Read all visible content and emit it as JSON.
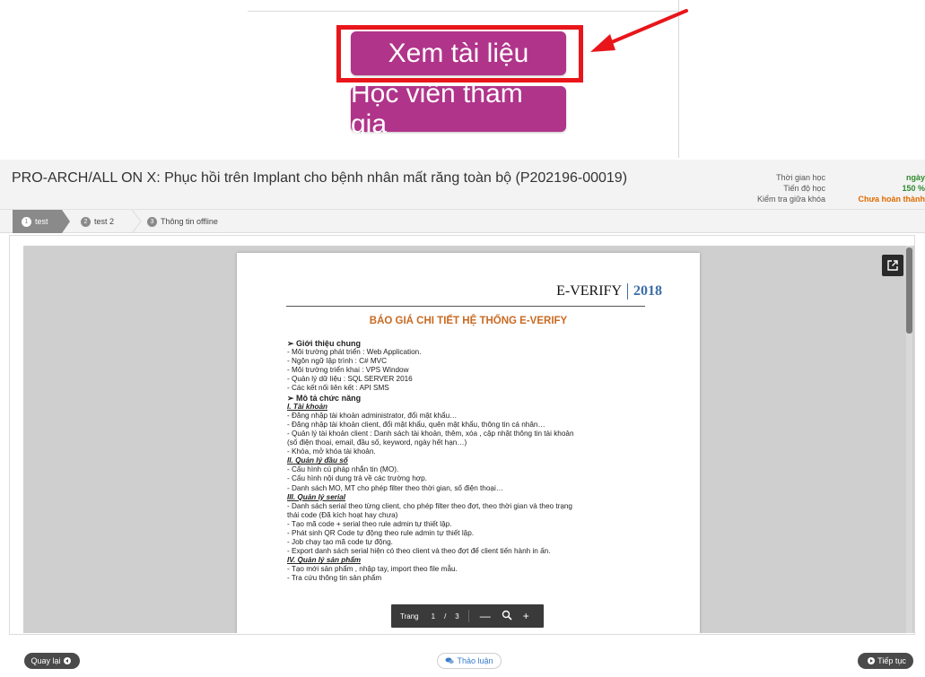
{
  "callout": {
    "primary_button": "Xem tài liệu",
    "secondary_button": "Học viên tham gia"
  },
  "header": {
    "course_title": "PRO-ARCH/ALL ON X: Phục hồi trên Implant cho bệnh nhân mất răng toàn bộ (P202196-00019)",
    "meta_labels": [
      "Thời gian học",
      "Tiến độ học",
      "Kiểm tra giữa khóa"
    ],
    "meta_values": [
      "ngày",
      "150 %",
      "Chưa hoàn thành"
    ]
  },
  "tabs": [
    {
      "num": "1",
      "label": "test"
    },
    {
      "num": "2",
      "label": "test 2"
    },
    {
      "num": "3",
      "label": "Thông tin offline"
    }
  ],
  "document": {
    "brand": "E-VERIFY",
    "year": "2018",
    "title": "BÁO GIÁ CHI TIẾT HỆ THỐNG E-VERIFY",
    "lines": [
      {
        "t": "➢  Giới thiệu chung",
        "k": "h"
      },
      {
        "t": "-    Môi trường phát triển : Web Application.",
        "k": "b"
      },
      {
        "t": "-    Ngôn ngữ lập trình : C# MVC",
        "k": "b"
      },
      {
        "t": "-    Môi trường triển khai : VPS Window",
        "k": "b"
      },
      {
        "t": "-    Quản lý dữ liệu : SQL SERVER 2016",
        "k": "b"
      },
      {
        "t": "-    Các kết nối liên kết : API SMS",
        "k": "b"
      },
      {
        "t": "➢  Mô tả chức năng",
        "k": "h"
      },
      {
        "t": "I.     Tài khoản",
        "k": "r"
      },
      {
        "t": "-    Đăng nhập tài khoản administrator, đổi mật khẩu…",
        "k": "b"
      },
      {
        "t": "-    Đăng nhập tài khoản client, đổi mật khẩu, quên mật khẩu, thông tin cá nhân…",
        "k": "b"
      },
      {
        "t": "-    Quản lý tài khoản client : Danh sách tài khoản, thêm, xóa , cập nhật thông tin tài khoản",
        "k": "b"
      },
      {
        "t": "      (số điện thoại, email, đầu số, keyword, ngày hết hạn…)",
        "k": "b"
      },
      {
        "t": "-    Khóa, mở khóa tài khoản.",
        "k": "b"
      },
      {
        "t": "II.    Quản lý đầu số",
        "k": "r"
      },
      {
        "t": "-    Cấu hình cú pháp nhắn tin (MO).",
        "k": "b"
      },
      {
        "t": "-    Cấu  hình nội dung trả về các trường hợp.",
        "k": "b"
      },
      {
        "t": "-    Danh sách MO, MT cho phép filter theo thời gian, số điện thoại…",
        "k": "b"
      },
      {
        "t": "III.   Quản lý serial",
        "k": "r"
      },
      {
        "t": "-    Danh sách serial theo từng client, cho phép filter theo đợt, theo thời gian và theo trạng",
        "k": "b"
      },
      {
        "t": "      thái code (Đã kích hoạt hay chưa)",
        "k": "b"
      },
      {
        "t": "-    Tạo mã code + serial theo rule admin tự thiết lập.",
        "k": "b"
      },
      {
        "t": "-    Phát sinh QR Code tự động theo rule admin tự thiết lập.",
        "k": "b"
      },
      {
        "t": "-    Job chạy tạo mã code tự động.",
        "k": "b"
      },
      {
        "t": "-    Export danh sách serial hiện có theo client và theo đợt để client tiến hành in ấn.",
        "k": "b"
      },
      {
        "t": "IV.   Quản lý sản phẩm",
        "k": "r"
      },
      {
        "t": "-    Tạo mới sản phẩm , nhập tay, import theo file mẫu.",
        "k": "b"
      },
      {
        "t": "-    Tra cứu thông tin sản phẩm",
        "k": "b"
      }
    ]
  },
  "pager": {
    "label": "Trang",
    "current": "1",
    "slash": "/",
    "total": "3"
  },
  "footer": {
    "back": "Quay lại",
    "discuss": "Thảo luận",
    "next": "Tiếp tục"
  },
  "colors": {
    "button_purple": "#b0348a",
    "highlight_red": "#e8161b",
    "progress_green": "#2e8b2e",
    "status_orange": "#e06b00"
  }
}
